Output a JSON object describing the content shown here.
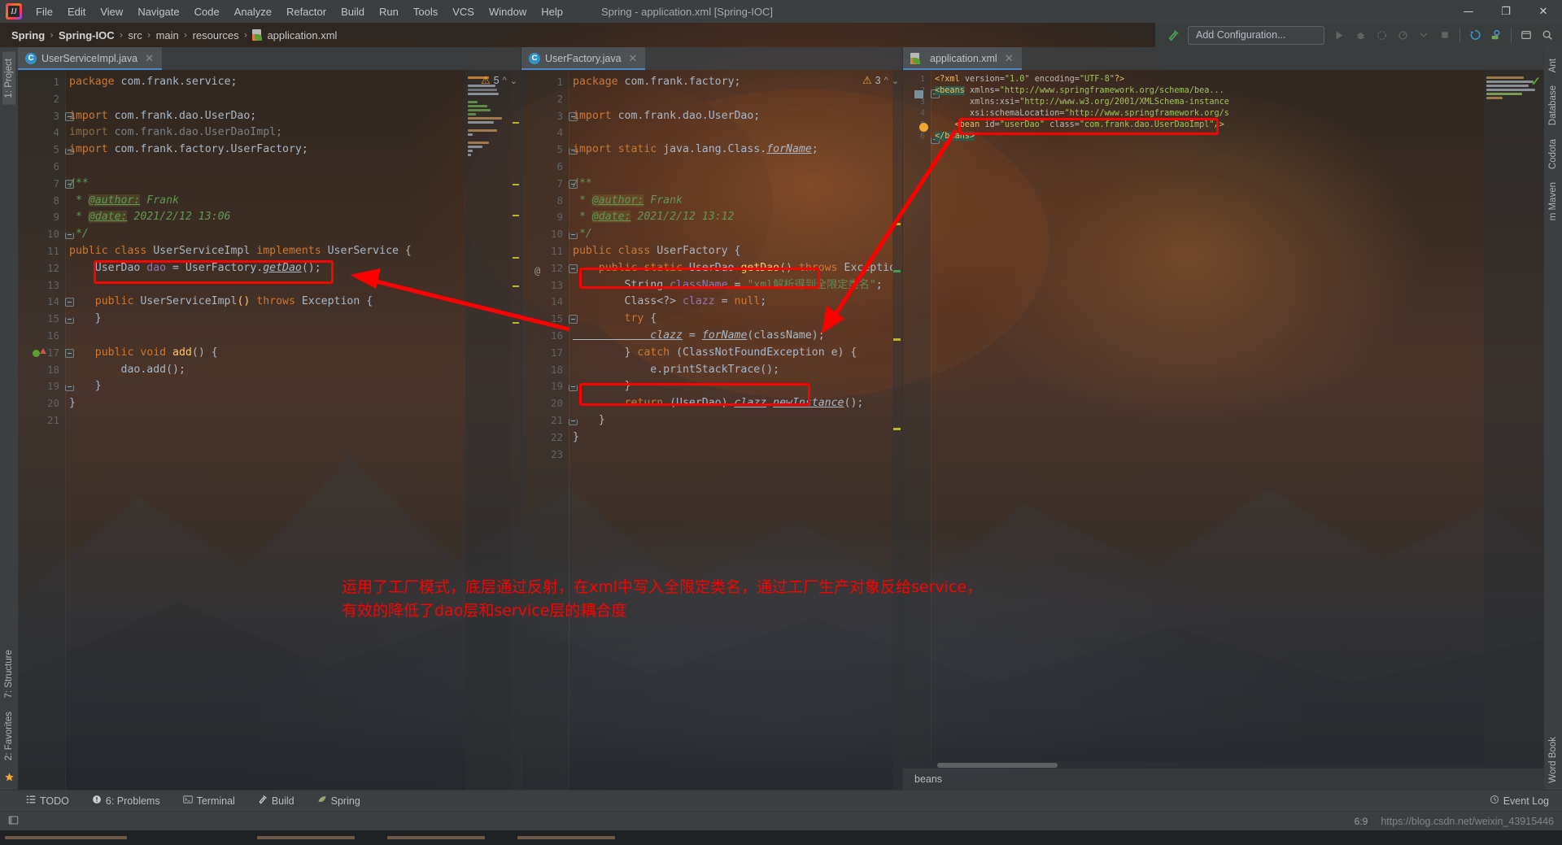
{
  "window": {
    "title": "Spring - application.xml [Spring-IOC]",
    "minimize": "—",
    "maximize": "❐",
    "close": "✕"
  },
  "menu": {
    "items": [
      "File",
      "Edit",
      "View",
      "Navigate",
      "Code",
      "Analyze",
      "Refactor",
      "Build",
      "Run",
      "Tools",
      "VCS",
      "Window",
      "Help"
    ]
  },
  "breadcrumb": {
    "items": [
      "Spring",
      "Spring-IOC",
      "src",
      "main",
      "resources",
      "application.xml"
    ],
    "separator": "›"
  },
  "toolbar": {
    "add_configuration": "Add Configuration...",
    "icons": [
      "build-hammer-icon",
      "run-icon",
      "debug-icon",
      "run-with-coverage-icon",
      "profile-icon",
      "dropdown-icon",
      "stop-icon",
      "git-update-icon",
      "search-everywhere-icon",
      "settings-icon",
      "search-icon"
    ]
  },
  "left_strip": {
    "tabs": [
      "1: Project",
      "7: Structure",
      "2: Favorites"
    ],
    "star_icon": "star-icon"
  },
  "right_strip": {
    "tabs": [
      "Ant",
      "Database",
      "Codota",
      "m Maven",
      "Word Book"
    ]
  },
  "editors": [
    {
      "tab_label": "UserServiceImpl.java",
      "tab_icon": "java-class-icon",
      "close_icon": "✕",
      "warning_count": "5",
      "warning_icon": "warning-triangle-icon",
      "lines": [
        {
          "n": "1",
          "tokens": [
            {
              "t": "package ",
              "c": "kw"
            },
            {
              "t": "com.frank.service;",
              "c": "id"
            }
          ]
        },
        {
          "n": "2",
          "tokens": []
        },
        {
          "n": "3",
          "tokens": [
            {
              "t": "import ",
              "c": "kw"
            },
            {
              "t": "com.frank.dao.UserDao;",
              "c": "id"
            }
          ],
          "fold": "start"
        },
        {
          "n": "4",
          "tokens": [
            {
              "t": "import ",
              "c": "kwdim"
            },
            {
              "t": "com.frank.dao.UserDaoImpl;",
              "c": "dim"
            }
          ]
        },
        {
          "n": "5",
          "tokens": [
            {
              "t": "import ",
              "c": "kw"
            },
            {
              "t": "com.frank.factory.UserFactory;",
              "c": "id"
            }
          ],
          "fold": "end"
        },
        {
          "n": "6",
          "tokens": []
        },
        {
          "n": "7",
          "tokens": [
            {
              "t": "/**",
              "c": "cmt"
            }
          ],
          "fold": "start"
        },
        {
          "n": "8",
          "tokens": [
            {
              "t": " * ",
              "c": "cmt"
            },
            {
              "t": "@author:",
              "c": "jdt"
            },
            {
              "t": " Frank",
              "c": "cmt"
            }
          ]
        },
        {
          "n": "9",
          "tokens": [
            {
              "t": " * ",
              "c": "cmt"
            },
            {
              "t": "@date:",
              "c": "jdt"
            },
            {
              "t": " 2021/2/12 13:06",
              "c": "cmt"
            }
          ]
        },
        {
          "n": "10",
          "tokens": [
            {
              "t": " */",
              "c": "cmt"
            }
          ],
          "fold": "end"
        },
        {
          "n": "11",
          "tokens": [
            {
              "t": "public class ",
              "c": "kw"
            },
            {
              "t": "UserServiceImpl ",
              "c": "cls"
            },
            {
              "t": "implements ",
              "c": "kw"
            },
            {
              "t": "UserService {",
              "c": "cls"
            }
          ]
        },
        {
          "n": "12",
          "tokens": [
            {
              "t": "    UserDao ",
              "c": "cls"
            },
            {
              "t": "dao ",
              "c": "fld"
            },
            {
              "t": "= UserFactory.",
              "c": "id"
            },
            {
              "t": "getDao",
              "c": "sfld"
            },
            {
              "t": "();",
              "c": "id"
            }
          ]
        },
        {
          "n": "13",
          "tokens": []
        },
        {
          "n": "14",
          "tokens": [
            {
              "t": "    public ",
              "c": "kw"
            },
            {
              "t": "UserServiceImpl",
              "c": "cls"
            },
            {
              "t": "() ",
              "c": "mth"
            },
            {
              "t": "throws ",
              "c": "kw"
            },
            {
              "t": "Exception {",
              "c": "cls"
            }
          ],
          "fold": "start"
        },
        {
          "n": "15",
          "tokens": [
            {
              "t": "    }",
              "c": "id"
            }
          ],
          "fold": "end"
        },
        {
          "n": "16",
          "tokens": []
        },
        {
          "n": "17",
          "tokens": [
            {
              "t": "    public void ",
              "c": "kw"
            },
            {
              "t": "add",
              "c": "mth"
            },
            {
              "t": "() {",
              "c": "id"
            }
          ],
          "fold": "start",
          "gutter_mark": "override-icon"
        },
        {
          "n": "18",
          "tokens": [
            {
              "t": "        dao.",
              "c": "id"
            },
            {
              "t": "add",
              "c": "id"
            },
            {
              "t": "();",
              "c": "id"
            }
          ]
        },
        {
          "n": "19",
          "tokens": [
            {
              "t": "    }",
              "c": "id"
            }
          ],
          "fold": "end"
        },
        {
          "n": "20",
          "tokens": [
            {
              "t": "}",
              "c": "id"
            }
          ]
        },
        {
          "n": "21",
          "tokens": []
        }
      ]
    },
    {
      "tab_label": "UserFactory.java",
      "tab_icon": "java-class-icon",
      "close_icon": "✕",
      "warning_count": "3",
      "warning_icon": "warning-triangle-icon",
      "lines": [
        {
          "n": "1",
          "tokens": [
            {
              "t": "package ",
              "c": "kw"
            },
            {
              "t": "com.frank.factory;",
              "c": "id"
            }
          ]
        },
        {
          "n": "2",
          "tokens": []
        },
        {
          "n": "3",
          "tokens": [
            {
              "t": "import ",
              "c": "kw"
            },
            {
              "t": "com.frank.dao.UserDao;",
              "c": "id"
            }
          ],
          "fold": "start"
        },
        {
          "n": "4",
          "tokens": []
        },
        {
          "n": "5",
          "tokens": [
            {
              "t": "import static ",
              "c": "kw"
            },
            {
              "t": "java.lang.Class.",
              "c": "id"
            },
            {
              "t": "forName",
              "c": "sfld"
            },
            {
              "t": ";",
              "c": "id"
            }
          ],
          "fold": "end"
        },
        {
          "n": "6",
          "tokens": []
        },
        {
          "n": "7",
          "tokens": [
            {
              "t": "/**",
              "c": "cmt"
            }
          ],
          "fold": "start"
        },
        {
          "n": "8",
          "tokens": [
            {
              "t": " * ",
              "c": "cmt"
            },
            {
              "t": "@author:",
              "c": "jdt"
            },
            {
              "t": " Frank",
              "c": "cmt"
            }
          ]
        },
        {
          "n": "9",
          "tokens": [
            {
              "t": " * ",
              "c": "cmt"
            },
            {
              "t": "@date:",
              "c": "jdt"
            },
            {
              "t": " 2021/2/12 13:12",
              "c": "cmt"
            }
          ]
        },
        {
          "n": "10",
          "tokens": [
            {
              "t": " */",
              "c": "cmt"
            }
          ],
          "fold": "end"
        },
        {
          "n": "11",
          "tokens": [
            {
              "t": "public class ",
              "c": "kw"
            },
            {
              "t": "UserFactory {",
              "c": "cls"
            }
          ]
        },
        {
          "n": "12",
          "tokens": [
            {
              "t": "    public static ",
              "c": "kw"
            },
            {
              "t": "UserDao ",
              "c": "cls"
            },
            {
              "t": "getDao",
              "c": "mth"
            },
            {
              "t": "() ",
              "c": "id"
            },
            {
              "t": "throws ",
              "c": "kw"
            },
            {
              "t": "Exception {",
              "c": "cls"
            }
          ],
          "fold": "start",
          "gutter_mark": "at-icon"
        },
        {
          "n": "13",
          "tokens": [
            {
              "t": "        String ",
              "c": "cls"
            },
            {
              "t": "className ",
              "c": "fld"
            },
            {
              "t": "= ",
              "c": "id"
            },
            {
              "t": "\"xml解析得到全限定类名\"",
              "c": "str"
            },
            {
              "t": ";",
              "c": "id"
            }
          ]
        },
        {
          "n": "14",
          "tokens": [
            {
              "t": "        Class<?> ",
              "c": "cls"
            },
            {
              "t": "clazz ",
              "c": "fld"
            },
            {
              "t": "= ",
              "c": "id"
            },
            {
              "t": "null",
              "c": "kw"
            },
            {
              "t": ";",
              "c": "id"
            }
          ]
        },
        {
          "n": "15",
          "tokens": [
            {
              "t": "        try ",
              "c": "kw"
            },
            {
              "t": "{",
              "c": "id"
            }
          ],
          "fold": "start"
        },
        {
          "n": "16",
          "tokens": [
            {
              "t": "            clazz",
              "c": "sfld"
            },
            {
              "t": " = ",
              "c": "id"
            },
            {
              "t": "forName",
              "c": "sfld"
            },
            {
              "t": "(className);",
              "c": "id"
            }
          ]
        },
        {
          "n": "17",
          "tokens": [
            {
              "t": "        } ",
              "c": "id"
            },
            {
              "t": "catch ",
              "c": "kw"
            },
            {
              "t": "(ClassNotFoundException e) {",
              "c": "id"
            }
          ]
        },
        {
          "n": "18",
          "tokens": [
            {
              "t": "            e.printStackTrace();",
              "c": "id"
            }
          ]
        },
        {
          "n": "19",
          "tokens": [
            {
              "t": "        }",
              "c": "id"
            }
          ],
          "fold": "end"
        },
        {
          "n": "20",
          "tokens": [
            {
              "t": "        return ",
              "c": "kw"
            },
            {
              "t": "(UserDao) ",
              "c": "id"
            },
            {
              "t": "clazz",
              "c": "sfld"
            },
            {
              "t": ".",
              "c": "id"
            },
            {
              "t": "newInstance",
              "c": "sfld"
            },
            {
              "t": "();",
              "c": "id"
            }
          ]
        },
        {
          "n": "21",
          "tokens": [
            {
              "t": "    }",
              "c": "id"
            }
          ],
          "fold": "end"
        },
        {
          "n": "22",
          "tokens": [
            {
              "t": "}",
              "c": "id"
            }
          ]
        },
        {
          "n": "23",
          "tokens": []
        }
      ]
    },
    {
      "tab_label": "application.xml",
      "tab_icon": "xml-spring-icon",
      "close_icon": "✕",
      "ok_icon": "check-icon",
      "lines": [
        {
          "n": "1",
          "tokens": [
            {
              "t": "<?xml ",
              "c": "tag"
            },
            {
              "t": "version=",
              "c": "attr"
            },
            {
              "t": "\"1.0\" ",
              "c": "avl"
            },
            {
              "t": "encoding=",
              "c": "attr"
            },
            {
              "t": "\"UTF-8\"",
              "c": "avl"
            },
            {
              "t": "?>",
              "c": "tag"
            }
          ]
        },
        {
          "n": "2",
          "tokens": [
            {
              "t": "<beans",
              "c": "beansel"
            },
            {
              "t": " xmlns=",
              "c": "attr"
            },
            {
              "t": "\"http://www.springframework.org/schema/bea...",
              "c": "avl"
            }
          ],
          "fold": "start",
          "gutter_mark": "xml-icon"
        },
        {
          "n": "3",
          "tokens": [
            {
              "t": "       xmlns:xsi=",
              "c": "attr"
            },
            {
              "t": "\"http://www.w3.org/2001/XMLSchema-instance",
              "c": "avl"
            }
          ]
        },
        {
          "n": "4",
          "tokens": [
            {
              "t": "       xsi:schemaLocation=",
              "c": "attr"
            },
            {
              "t": "\"http://www.springframework.org/s",
              "c": "avl"
            }
          ]
        },
        {
          "n": "5",
          "tokens": [
            {
              "t": "    <bean ",
              "c": "tag"
            },
            {
              "t": "id=",
              "c": "attr"
            },
            {
              "t": "\"userDao\" ",
              "c": "avl"
            },
            {
              "t": "class=",
              "c": "attr"
            },
            {
              "t": "\"com.frank.dao.UserDaoImpl\"",
              "c": "avl"
            },
            {
              "t": "/>",
              "c": "tag"
            }
          ],
          "gutter_mark": "bulb-icon"
        },
        {
          "n": "6",
          "tokens": [
            {
              "t": "</beans>",
              "c": "beansel"
            }
          ],
          "fold": "end"
        }
      ],
      "structure_label": "beans"
    }
  ],
  "annotation": {
    "text": "运用了工厂模式，底层通过反射，在xml中写入全限定类名，通过工厂生产对象反给service，\n有效的降低了dao层和service层的耦合度",
    "color": "#ff0000"
  },
  "bottom_bar": {
    "items": [
      {
        "label": "TODO",
        "icon": "todo-list-icon"
      },
      {
        "label": "6: Problems",
        "icon": "problems-icon"
      },
      {
        "label": "Terminal",
        "icon": "terminal-icon"
      },
      {
        "label": "Build",
        "icon": "build-hammer-icon"
      },
      {
        "label": "Spring",
        "icon": "spring-leaf-icon"
      }
    ],
    "event_log": "Event Log",
    "event_log_icon": "event-log-icon"
  },
  "status_bar": {
    "caret_position": "6:9",
    "watermark": "https://blog.csdn.net/weixin_43915446"
  }
}
